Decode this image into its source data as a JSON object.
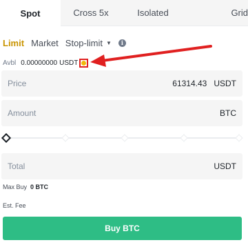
{
  "tabs": [
    {
      "label": "Spot",
      "active": true
    },
    {
      "label": "Cross 5x",
      "active": false
    },
    {
      "label": "Isolated",
      "active": false
    },
    {
      "label": "Grid",
      "active": false
    }
  ],
  "order_types": {
    "limit": "Limit",
    "market": "Market",
    "stop_limit": "Stop-limit",
    "info_glyph": "i"
  },
  "avbl": {
    "label": "Avbl",
    "value": "0.00000000",
    "unit": "USDT",
    "transfer_icon": "transfer-icon",
    "annotation_color": "#e02020"
  },
  "price": {
    "label": "Price",
    "value": "61314.43",
    "unit": "USDT"
  },
  "amount": {
    "label": "Amount",
    "value": "",
    "unit": "BTC"
  },
  "slider": {
    "value_percent": 0
  },
  "total": {
    "label": "Total",
    "value": "",
    "unit": "USDT"
  },
  "max_buy": {
    "label": "Max Buy",
    "value": "0 BTC"
  },
  "est_fee": {
    "label": "Est. Fee"
  },
  "buy_button": {
    "label": "Buy BTC"
  },
  "colors": {
    "accent": "#c99400",
    "buy": "#2ebd85",
    "annotation": "#e02020"
  }
}
